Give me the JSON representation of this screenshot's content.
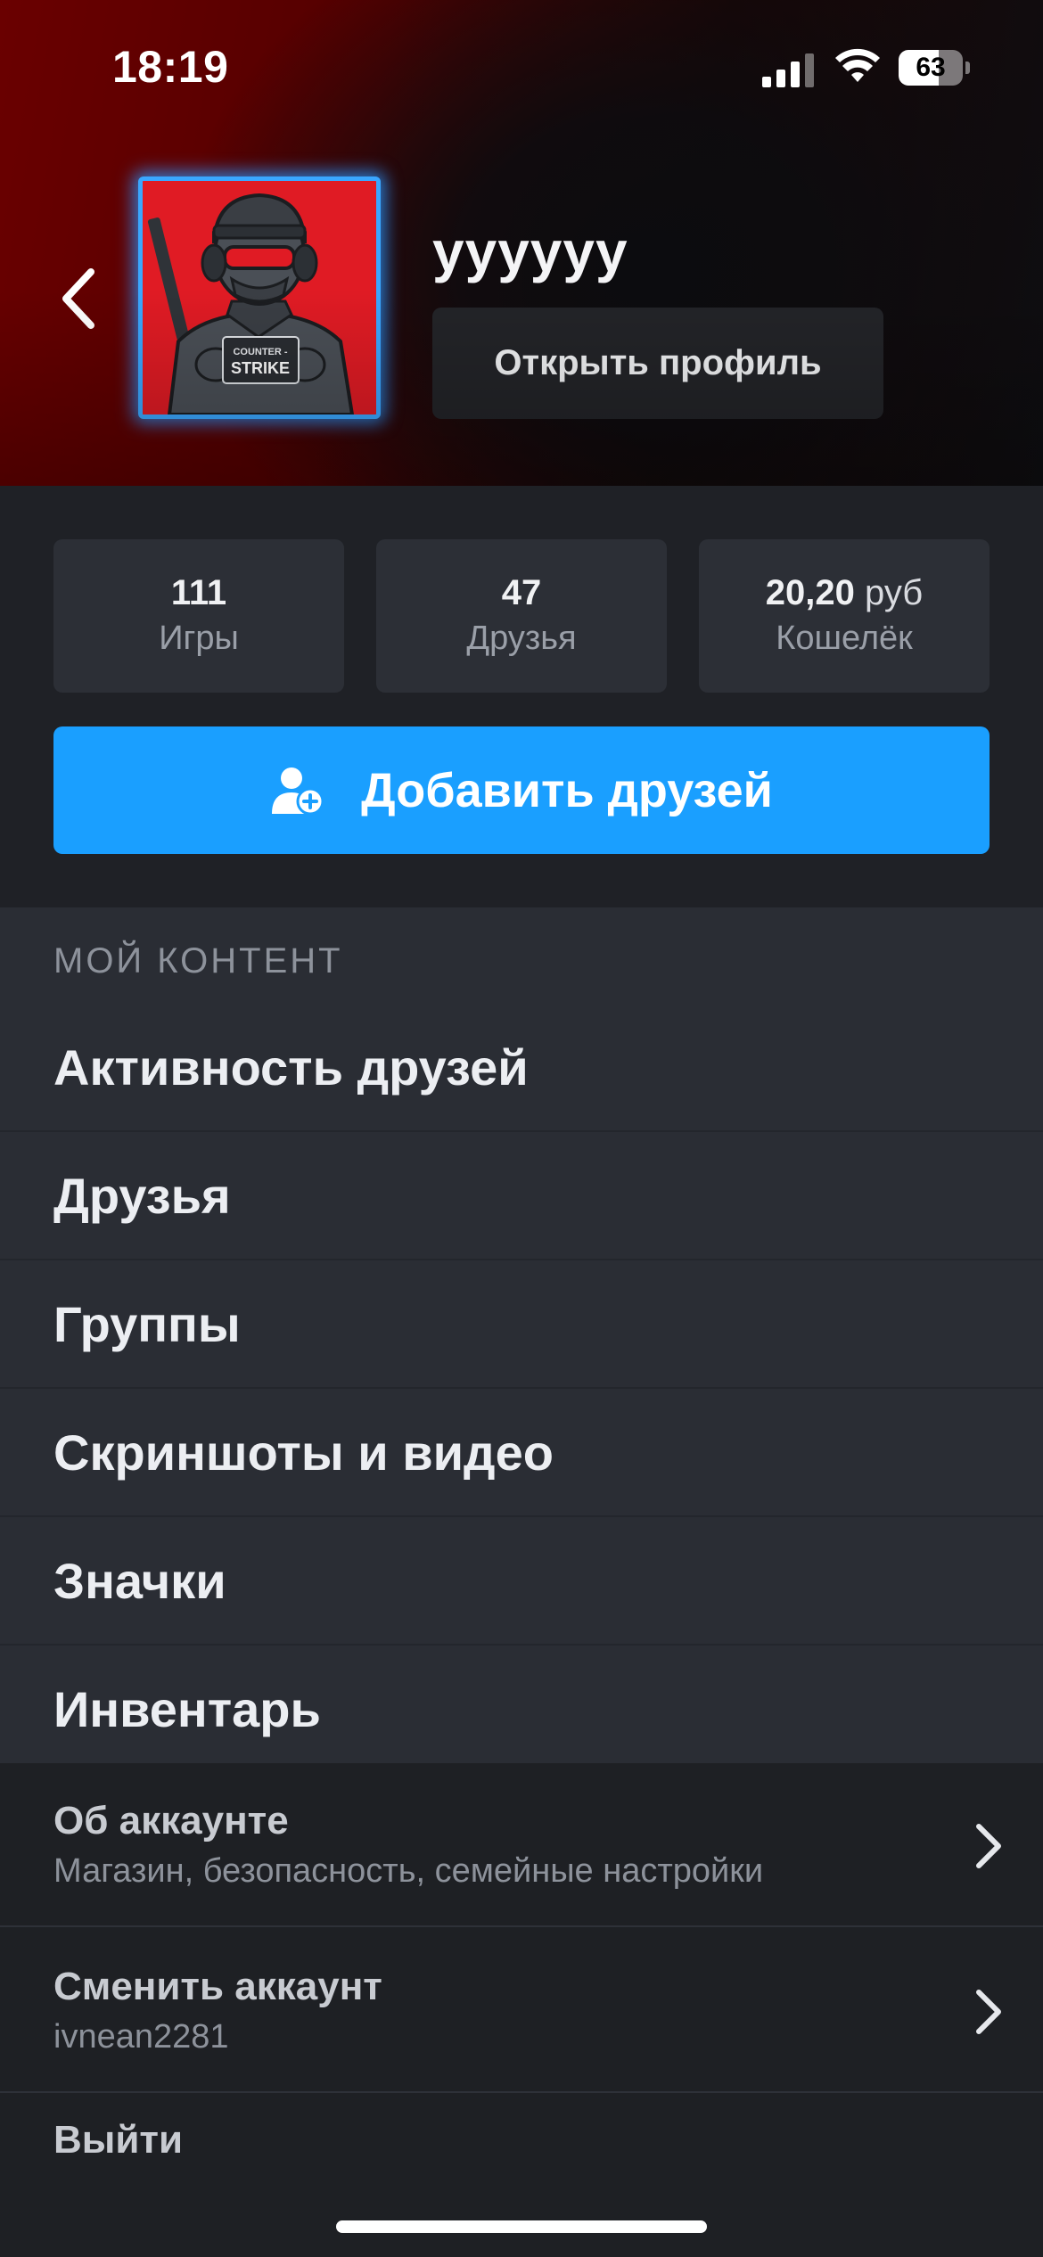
{
  "status_bar": {
    "time": "18:19",
    "battery_percent": 63,
    "battery_label": "63",
    "signal_icon": "cellular-signal-icon",
    "wifi_icon": "wifi-icon"
  },
  "profile": {
    "username": "уууууу",
    "open_profile_label": "Открыть профиль",
    "avatar_text_line1": "COUNTER -",
    "avatar_text_line2": "STRIKE",
    "avatar_color": "#e01b24",
    "avatar_frame_color": "#3aa7ff"
  },
  "stats": [
    {
      "value": "111",
      "unit": "",
      "label": "Игры"
    },
    {
      "value": "47",
      "unit": "",
      "label": "Друзья"
    },
    {
      "value": "20,20",
      "unit": "руб",
      "label": "Кошелёк"
    }
  ],
  "add_friends": {
    "label": "Добавить друзей",
    "icon": "add-user-icon",
    "color": "#1a9fff"
  },
  "my_content": {
    "title": "МОЙ КОНТЕНТ",
    "items": [
      "Активность друзей",
      "Друзья",
      "Группы",
      "Скриншоты и видео",
      "Значки",
      "Инвентарь"
    ]
  },
  "account": {
    "about": {
      "title": "Об аккаунте",
      "subtitle": "Магазин, безопасность, семейные настройки"
    },
    "switch": {
      "title": "Сменить аккаунт",
      "subtitle": "ivnean2281"
    },
    "logout": "Выйти"
  }
}
